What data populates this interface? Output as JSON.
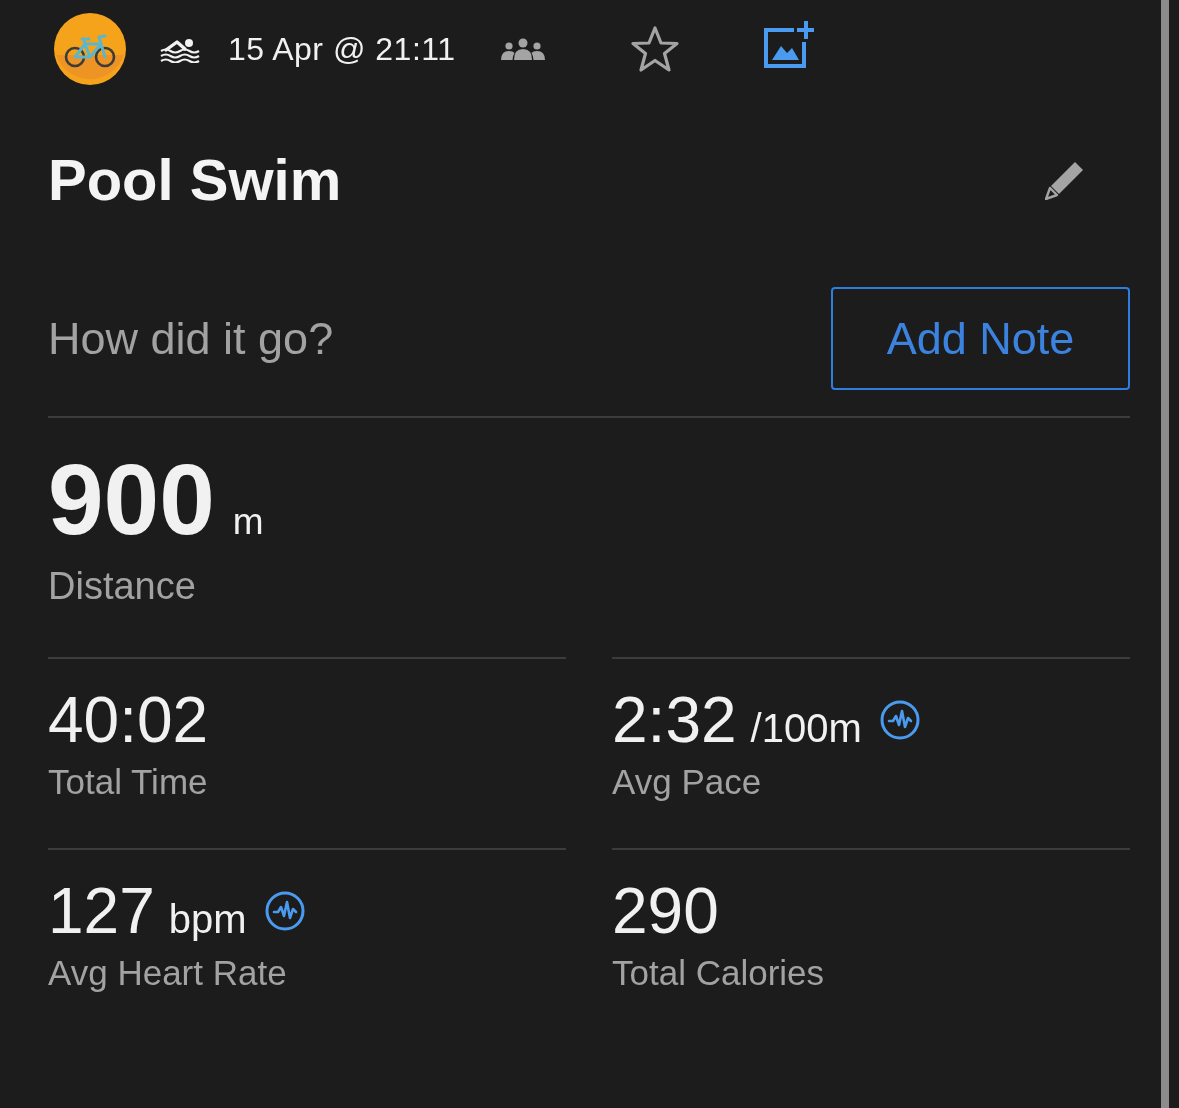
{
  "header": {
    "date": "15 Apr @ 21:11",
    "starred": false
  },
  "title": "Pool Swim",
  "note": {
    "prompt": "How did it go?",
    "button": "Add Note"
  },
  "distance": {
    "value": "900",
    "unit": "m",
    "label": "Distance"
  },
  "stats": [
    {
      "value": "40:02",
      "label": "Total Time",
      "chart_icon": false
    },
    {
      "value": "2:32",
      "unit": "/100m",
      "label": "Avg Pace",
      "chart_icon": true
    },
    {
      "value": "127",
      "unit": "bpm",
      "label": "Avg Heart Rate",
      "chart_icon": true
    },
    {
      "value": "290",
      "label": "Total Calories",
      "chart_icon": false
    }
  ]
}
